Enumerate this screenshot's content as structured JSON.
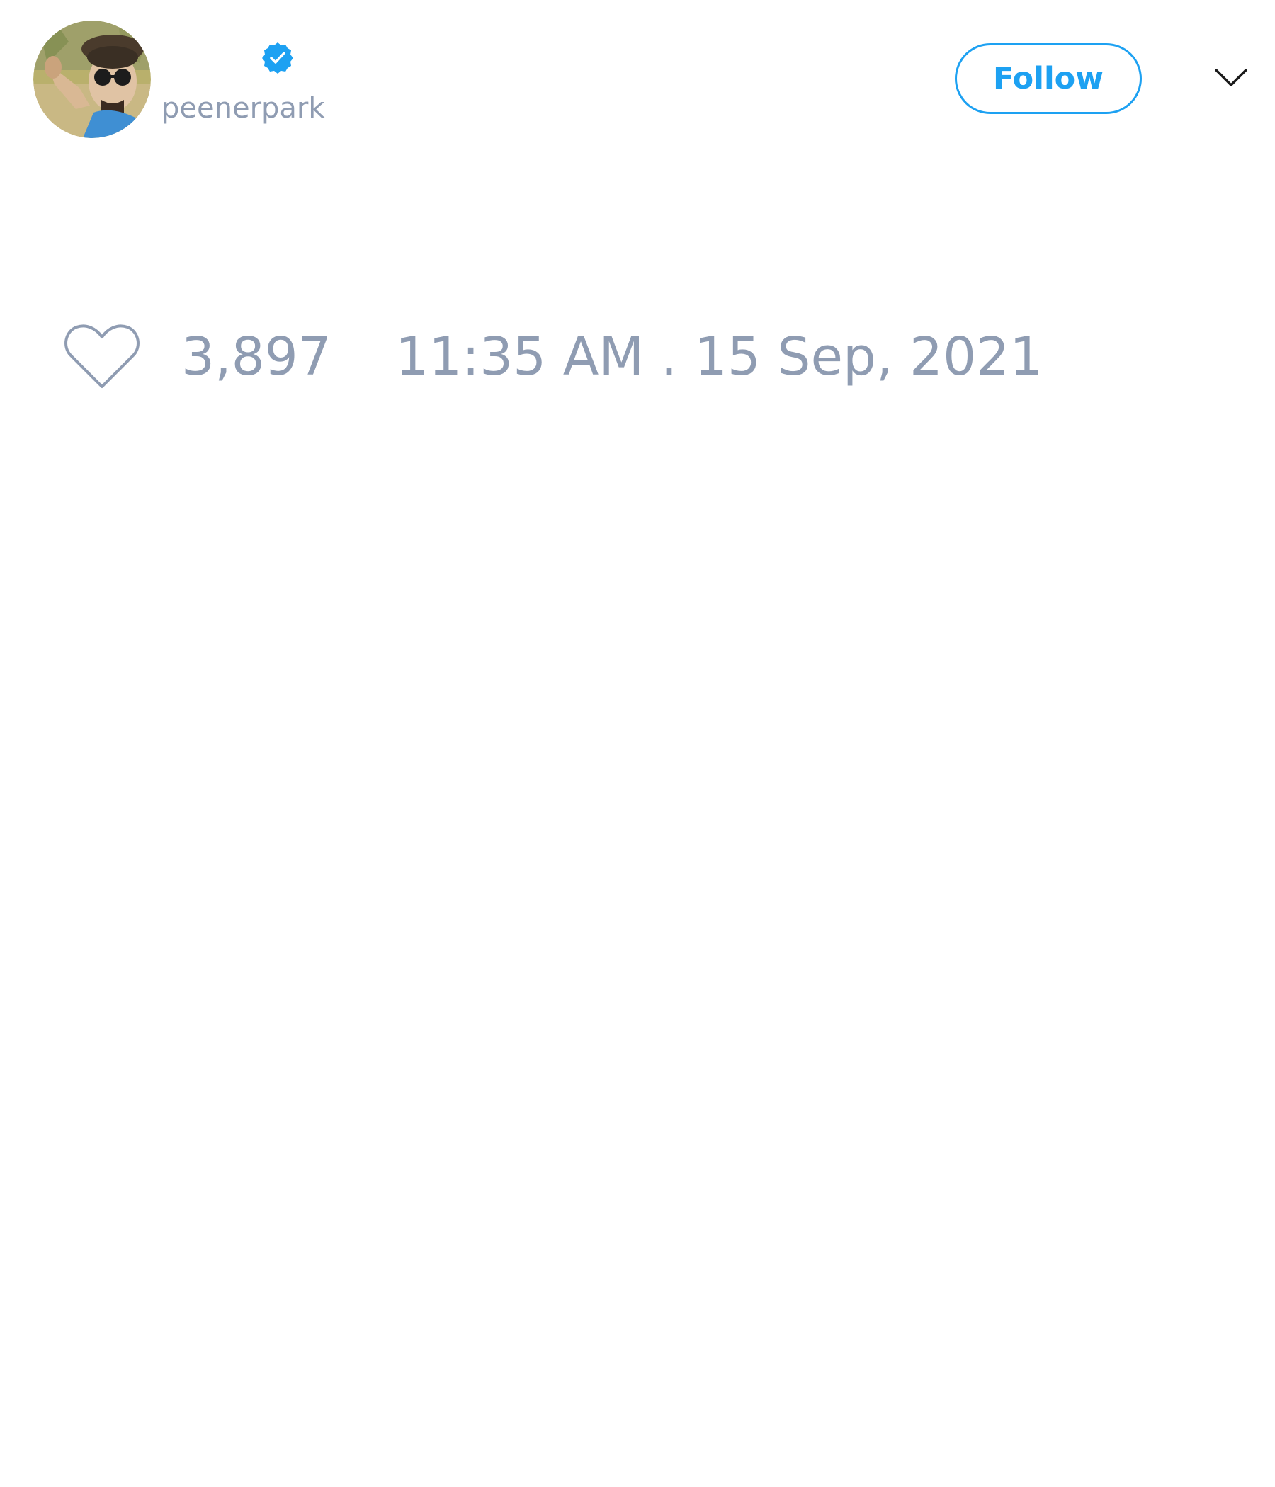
{
  "author": {
    "display_name": "",
    "handle": "peenerpark",
    "verified": true,
    "avatar_icon": "profile-photo"
  },
  "actions": {
    "follow_label": "Follow",
    "menu_icon": "chevron-down-icon"
  },
  "stats": {
    "like_icon": "heart-outline-icon",
    "like_count": "3,897",
    "timestamp": "11:35 AM . 15 Sep, 2021"
  },
  "colors": {
    "accent": "#1da1f2",
    "muted_text": "#8f9cb2",
    "background": "#ffffff"
  }
}
